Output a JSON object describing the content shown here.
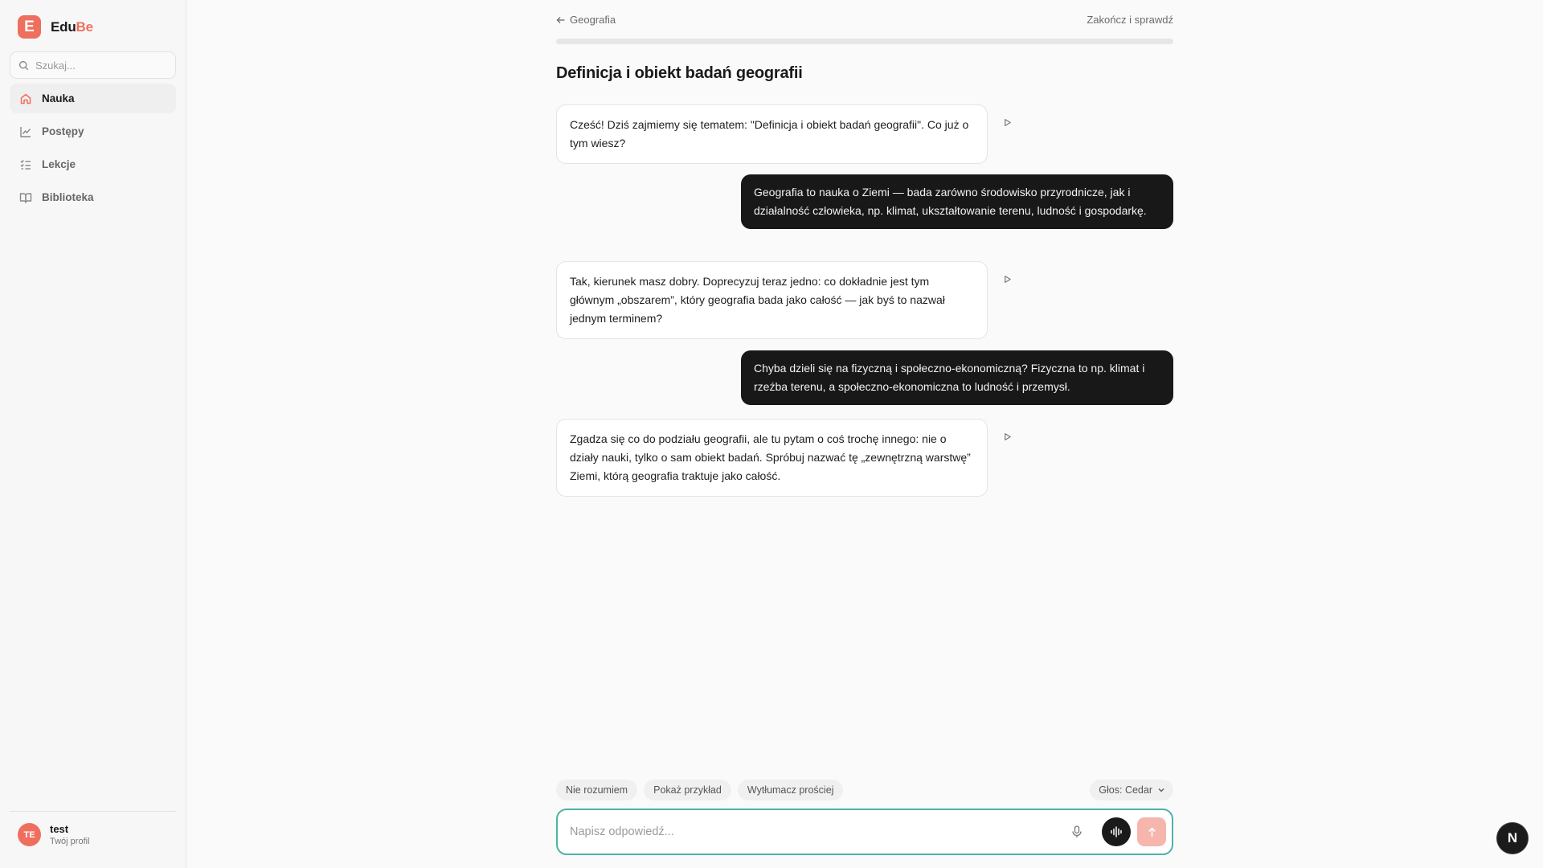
{
  "brand": {
    "logo_letter": "E",
    "name_part1": "Edu",
    "name_part2": "Be",
    "accent_color": "#ef6f5e"
  },
  "sidebar": {
    "search_placeholder": "Szukaj...",
    "items": [
      {
        "label": "Nauka",
        "icon": "home-icon",
        "active": true
      },
      {
        "label": "Postępy",
        "icon": "chart-line-icon",
        "active": false
      },
      {
        "label": "Lekcje",
        "icon": "list-check-icon",
        "active": false
      },
      {
        "label": "Biblioteka",
        "icon": "book-open-icon",
        "active": false
      }
    ],
    "profile": {
      "initials": "TE",
      "name": "test",
      "subtitle": "Twój profil"
    }
  },
  "header": {
    "back_label": "Geografia",
    "finish_label": "Zakończ i sprawdź"
  },
  "lesson": {
    "title": "Definicja i obiekt badań geografii",
    "progress_fraction": 1.0
  },
  "messages": [
    {
      "role": "assistant",
      "text": "Cześć! Dziś zajmiemy się tematem: \"Definicja i obiekt badań geografii\". Co już o tym wiesz?"
    },
    {
      "role": "user",
      "text": "Geografia to nauka o Ziemi — bada zarówno środowisko przyrodnicze, jak i działalność człowieka, np. klimat, ukształtowanie terenu, ludność i gospodarkę."
    },
    {
      "role": "assistant",
      "text": "Tak, kierunek masz dobry. Doprecyzuj teraz jedno: co dokładnie jest tym głównym „obszarem”, który geografia bada jako całość — jak byś to nazwał jednym terminem?"
    },
    {
      "role": "user",
      "text": "Chyba dzieli się na fizyczną i społeczno-ekonomiczną? Fizyczna to np. klimat i rzeźba terenu, a społeczno-ekonomiczna to ludność i przemysł."
    },
    {
      "role": "assistant",
      "text": "Zgadza się co do podziału geografii, ale tu pytam o coś trochę innego: nie o działy nauki, tylko o sam obiekt badań. Spróbuj nazwać tę „zewnętrzną warstwę” Ziemi, którą geografia traktuje jako całość."
    }
  ],
  "quick_replies": [
    "Nie rozumiem",
    "Pokaż przykład",
    "Wytłumacz prościej"
  ],
  "voice_select": {
    "label": "Głos: Cedar"
  },
  "composer": {
    "placeholder": "Napisz odpowiedź..."
  },
  "fab": {
    "letter": "N"
  }
}
